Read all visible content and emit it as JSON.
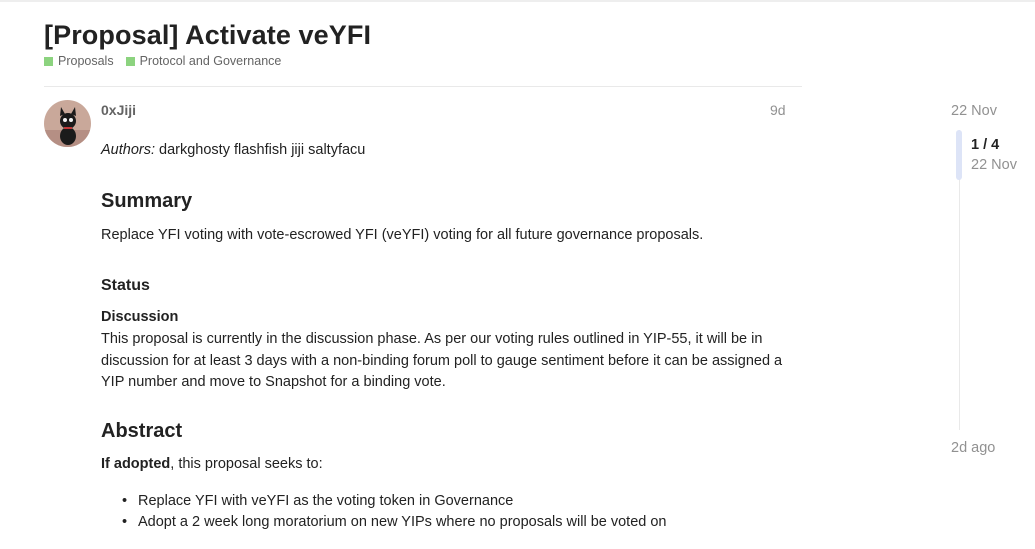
{
  "topic": {
    "title": "[Proposal] Activate veYFI",
    "categories": [
      {
        "label": "Proposals",
        "color": "#8cd37f"
      },
      {
        "label": "Protocol and Governance",
        "color": "#8cd37f"
      }
    ]
  },
  "post": {
    "username": "0xJiji",
    "date": "9d",
    "authors_label": "Authors:",
    "authors": "darkghosty flashfish jiji saltyfacu",
    "summary_heading": "Summary",
    "summary_text": "Replace YFI voting with vote-escrowed YFI (veYFI) voting for all future governance proposals.",
    "status_heading": "Status",
    "discussion_heading": "Discussion",
    "discussion_text": "This proposal is currently in the discussion phase. As per our voting rules outlined in YIP-55, it will be in discussion for at least 3 days with a non-binding forum poll to gauge sentiment before it can be assigned a YIP number and move to Snapshot for a binding vote.",
    "abstract_heading": "Abstract",
    "adopted_bold": "If adopted",
    "adopted_rest": ", this proposal seeks to:",
    "items": [
      "Replace YFI with veYFI as the voting token in Governance",
      "Adopt a 2 week long moratorium on new YIPs where no proposals will be voted on"
    ]
  },
  "timeline": {
    "start_date": "22 Nov",
    "position": "1 / 4",
    "position_date": "22 Nov",
    "end_label": "2d ago"
  }
}
